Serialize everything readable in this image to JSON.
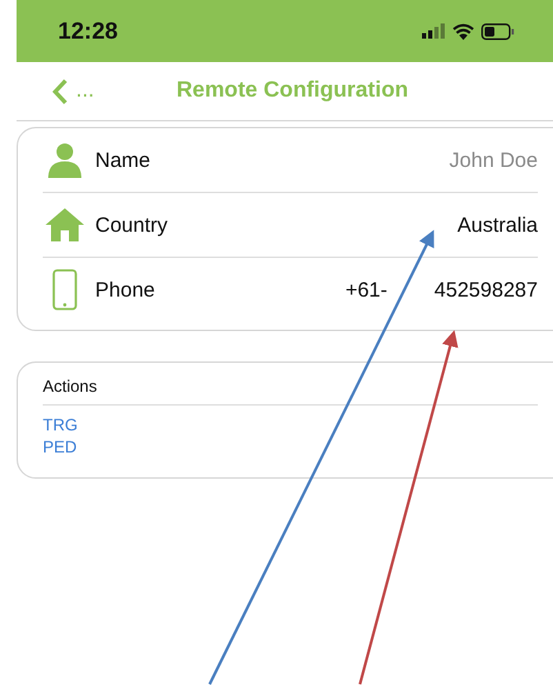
{
  "status_bar": {
    "time": "12:28"
  },
  "nav_bar": {
    "back_label": "...",
    "title": "Remote Configuration"
  },
  "profile": {
    "rows": [
      {
        "kind": "name",
        "label": "Name",
        "placeholder": "John Doe"
      },
      {
        "kind": "country",
        "label": "Country",
        "value": "Australia"
      },
      {
        "kind": "phone",
        "label": "Phone",
        "prefix": "+61-",
        "value": "452598287"
      }
    ]
  },
  "actions": {
    "title": "Actions",
    "links": [
      "TRG",
      "PED"
    ]
  }
}
